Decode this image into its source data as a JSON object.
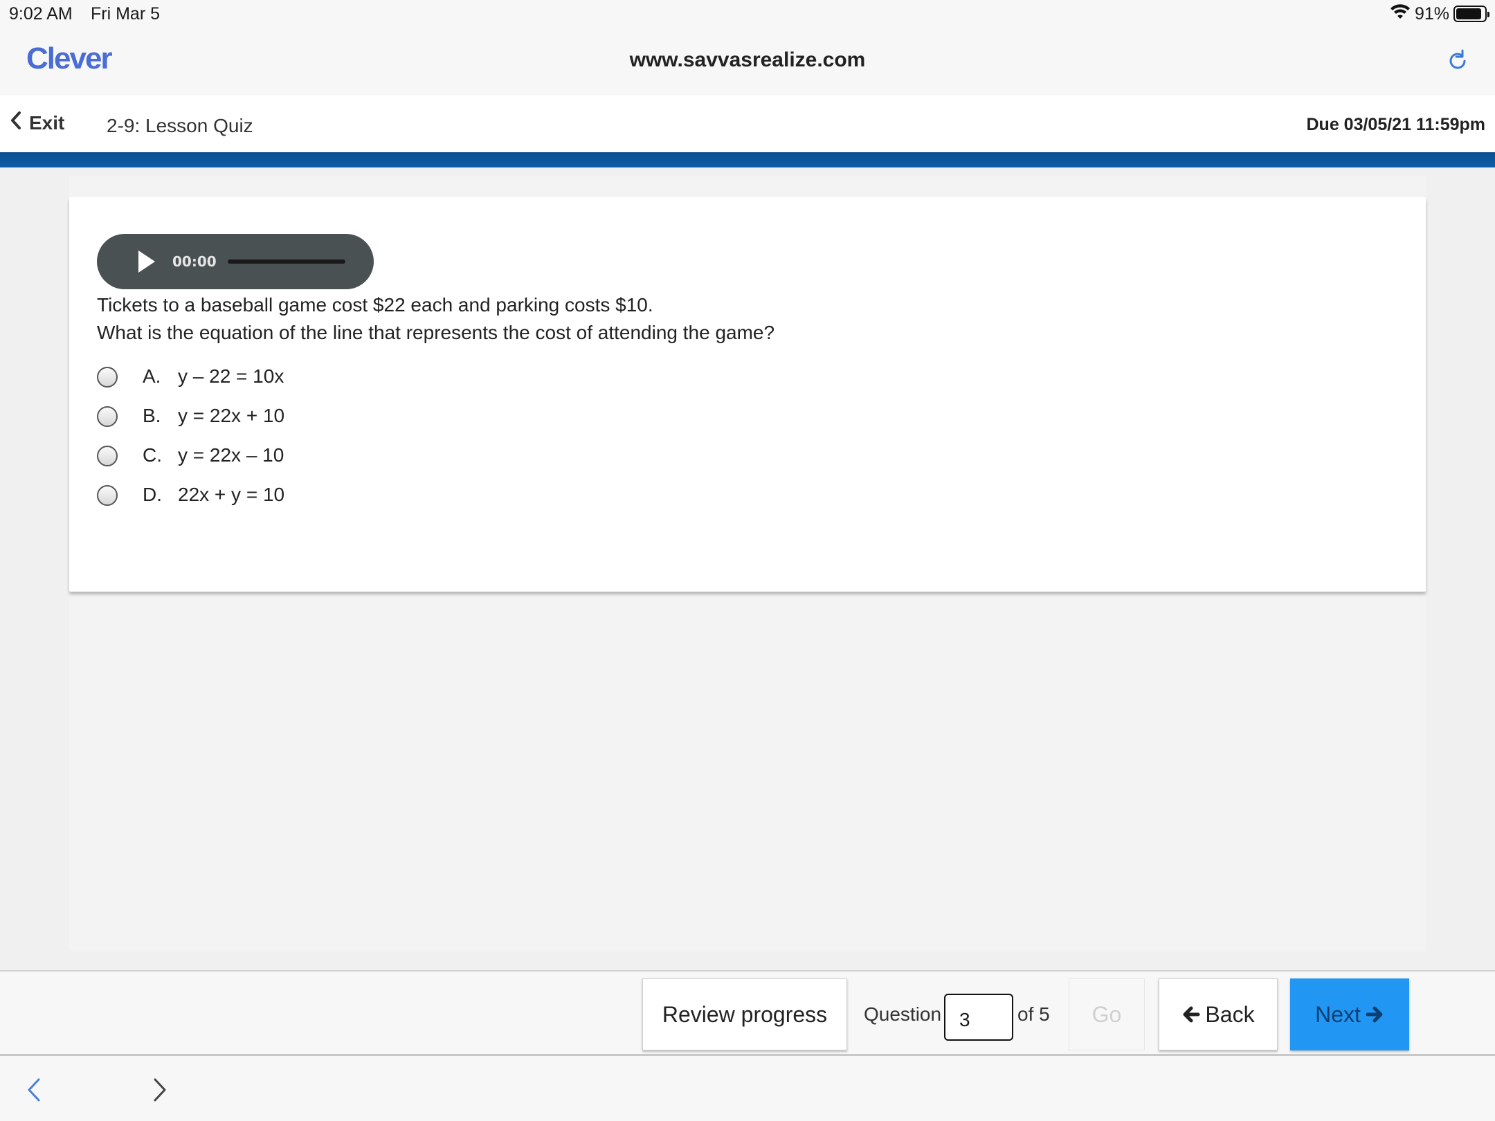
{
  "status_bar": {
    "time": "9:02 AM",
    "date": "Fri Mar 5",
    "battery": "91%",
    "battery_level": 0.91
  },
  "browser": {
    "logo": "Clever",
    "url": "www.savvasrealize.com"
  },
  "header": {
    "exit_label": "Exit",
    "lesson_title": "2-9: Lesson Quiz",
    "due": "Due 03/05/21 11:59pm"
  },
  "audio": {
    "time": "00:00"
  },
  "question": {
    "line1": "Tickets to a baseball game cost $22 each and parking costs $10.",
    "line2": "What is the equation of the line that represents the cost of attending the game?",
    "choices": [
      {
        "letter": "A.",
        "equation": "y – 22 = 10x"
      },
      {
        "letter": "B.",
        "equation": "y = 22x + 10"
      },
      {
        "letter": "C.",
        "equation": "y = 22x – 10"
      },
      {
        "letter": "D.",
        "equation": "22x + y = 10"
      }
    ]
  },
  "footer": {
    "review_label": "Review progress",
    "question_label": "Question",
    "question_value": "3",
    "of_label": "of 5",
    "go_label": "Go",
    "back_label": "Back",
    "next_label": "Next"
  },
  "colors": {
    "brand_blue": "#4a6cd4",
    "header_rule": "#0d5ea8",
    "next_button": "#2196f3"
  }
}
